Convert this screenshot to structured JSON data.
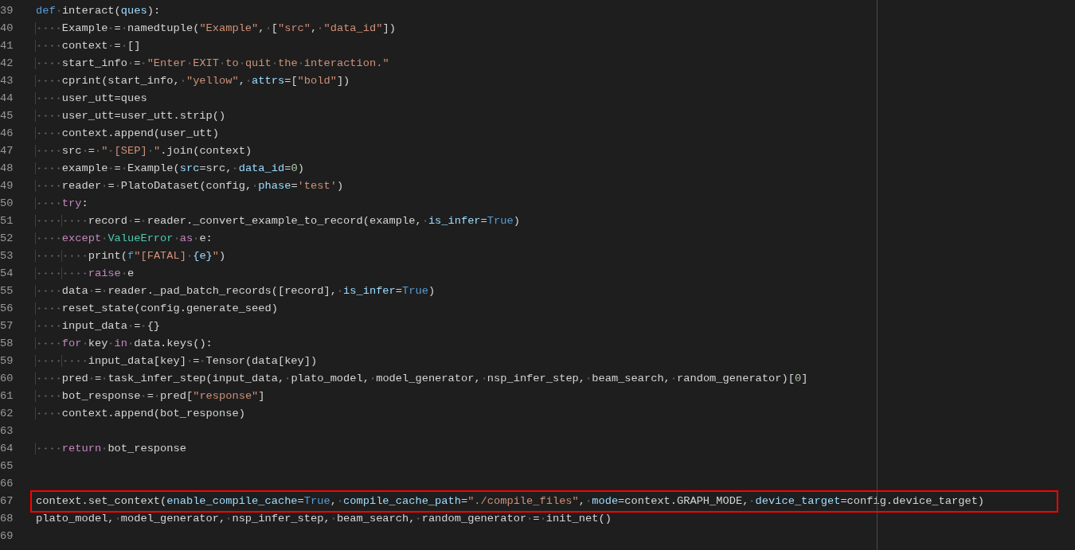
{
  "editor": {
    "lines": [
      {
        "number": "39",
        "highlighted": false,
        "tokens": [
          {
            "text": "def",
            "kind": "keyword"
          },
          {
            "text": " interact(",
            "kind": "plain"
          },
          {
            "text": "ques",
            "kind": "param"
          },
          {
            "text": "):",
            "kind": "plain"
          }
        ]
      },
      {
        "number": "40",
        "highlighted": false,
        "tokens": [
          {
            "text": "    Example = namedtuple(",
            "kind": "plain"
          },
          {
            "text": "\"Example\"",
            "kind": "string"
          },
          {
            "text": ", [",
            "kind": "plain"
          },
          {
            "text": "\"src\"",
            "kind": "string"
          },
          {
            "text": ", ",
            "kind": "plain"
          },
          {
            "text": "\"data_id\"",
            "kind": "string"
          },
          {
            "text": "])",
            "kind": "plain"
          }
        ]
      },
      {
        "number": "41",
        "highlighted": false,
        "tokens": [
          {
            "text": "    context = []",
            "kind": "plain"
          }
        ]
      },
      {
        "number": "42",
        "highlighted": false,
        "tokens": [
          {
            "text": "    start_info = ",
            "kind": "plain"
          },
          {
            "text": "\"Enter EXIT to quit the interaction.\"",
            "kind": "string"
          }
        ]
      },
      {
        "number": "43",
        "highlighted": false,
        "tokens": [
          {
            "text": "    cprint(start_info, ",
            "kind": "plain"
          },
          {
            "text": "\"yellow\"",
            "kind": "string"
          },
          {
            "text": ", ",
            "kind": "plain"
          },
          {
            "text": "attrs",
            "kind": "param"
          },
          {
            "text": "=[",
            "kind": "plain"
          },
          {
            "text": "\"bold\"",
            "kind": "string"
          },
          {
            "text": "])",
            "kind": "plain"
          }
        ]
      },
      {
        "number": "44",
        "highlighted": false,
        "tokens": [
          {
            "text": "    user_utt=ques",
            "kind": "plain"
          }
        ]
      },
      {
        "number": "45",
        "highlighted": false,
        "tokens": [
          {
            "text": "    user_utt=user_utt.strip()",
            "kind": "plain"
          }
        ]
      },
      {
        "number": "46",
        "highlighted": false,
        "tokens": [
          {
            "text": "    context.append(user_utt)",
            "kind": "plain"
          }
        ]
      },
      {
        "number": "47",
        "highlighted": false,
        "tokens": [
          {
            "text": "    src = ",
            "kind": "plain"
          },
          {
            "text": "\" [SEP] \"",
            "kind": "string"
          },
          {
            "text": ".join(context)",
            "kind": "plain"
          }
        ]
      },
      {
        "number": "48",
        "highlighted": false,
        "tokens": [
          {
            "text": "    example = Example(",
            "kind": "plain"
          },
          {
            "text": "src",
            "kind": "param"
          },
          {
            "text": "=src, ",
            "kind": "plain"
          },
          {
            "text": "data_id",
            "kind": "param"
          },
          {
            "text": "=",
            "kind": "plain"
          },
          {
            "text": "0",
            "kind": "number"
          },
          {
            "text": ")",
            "kind": "plain"
          }
        ]
      },
      {
        "number": "49",
        "highlighted": false,
        "tokens": [
          {
            "text": "    reader = PlatoDataset(config, ",
            "kind": "plain"
          },
          {
            "text": "phase",
            "kind": "param"
          },
          {
            "text": "=",
            "kind": "plain"
          },
          {
            "text": "'test'",
            "kind": "string"
          },
          {
            "text": ")",
            "kind": "plain"
          }
        ]
      },
      {
        "number": "50",
        "highlighted": false,
        "tokens": [
          {
            "text": "    try",
            "kind": "control"
          },
          {
            "text": ":",
            "kind": "plain"
          }
        ]
      },
      {
        "number": "51",
        "highlighted": false,
        "tokens": [
          {
            "text": "        record = reader._convert_example_to_record(example, ",
            "kind": "plain"
          },
          {
            "text": "is_infer",
            "kind": "param"
          },
          {
            "text": "=",
            "kind": "plain"
          },
          {
            "text": "True",
            "kind": "keyword"
          },
          {
            "text": ")",
            "kind": "plain"
          }
        ]
      },
      {
        "number": "52",
        "highlighted": false,
        "tokens": [
          {
            "text": "    except",
            "kind": "control"
          },
          {
            "text": " ValueError",
            "kind": "type"
          },
          {
            "text": " as",
            "kind": "control"
          },
          {
            "text": " e:",
            "kind": "plain"
          }
        ]
      },
      {
        "number": "53",
        "highlighted": false,
        "tokens": [
          {
            "text": "        print(",
            "kind": "plain"
          },
          {
            "text": "f",
            "kind": "keyword"
          },
          {
            "text": "\"[FATAL] ",
            "kind": "string"
          },
          {
            "text": "{e}",
            "kind": "param"
          },
          {
            "text": "\"",
            "kind": "string"
          },
          {
            "text": ")",
            "kind": "plain"
          }
        ]
      },
      {
        "number": "54",
        "highlighted": false,
        "tokens": [
          {
            "text": "        raise",
            "kind": "control"
          },
          {
            "text": " e",
            "kind": "plain"
          }
        ]
      },
      {
        "number": "55",
        "highlighted": false,
        "tokens": [
          {
            "text": "    data = reader._pad_batch_records([record], ",
            "kind": "plain"
          },
          {
            "text": "is_infer",
            "kind": "param"
          },
          {
            "text": "=",
            "kind": "plain"
          },
          {
            "text": "True",
            "kind": "keyword"
          },
          {
            "text": ")",
            "kind": "plain"
          }
        ]
      },
      {
        "number": "56",
        "highlighted": false,
        "tokens": [
          {
            "text": "    reset_state(config.generate_seed)",
            "kind": "plain"
          }
        ]
      },
      {
        "number": "57",
        "highlighted": false,
        "tokens": [
          {
            "text": "    input_data = {}",
            "kind": "plain"
          }
        ]
      },
      {
        "number": "58",
        "highlighted": false,
        "tokens": [
          {
            "text": "    for",
            "kind": "control"
          },
          {
            "text": " key ",
            "kind": "plain"
          },
          {
            "text": "in",
            "kind": "control"
          },
          {
            "text": " data.keys():",
            "kind": "plain"
          }
        ]
      },
      {
        "number": "59",
        "highlighted": false,
        "tokens": [
          {
            "text": "        input_data[key] = Tensor(data[key])",
            "kind": "plain"
          }
        ]
      },
      {
        "number": "60",
        "highlighted": false,
        "tokens": [
          {
            "text": "    pred = task_infer_step(input_data, plato_model, model_generator, nsp_infer_step, beam_search, random_generator)[",
            "kind": "plain"
          },
          {
            "text": "0",
            "kind": "number"
          },
          {
            "text": "]",
            "kind": "plain"
          }
        ]
      },
      {
        "number": "61",
        "highlighted": false,
        "tokens": [
          {
            "text": "    bot_response = pred[",
            "kind": "plain"
          },
          {
            "text": "\"response\"",
            "kind": "string"
          },
          {
            "text": "]",
            "kind": "plain"
          }
        ]
      },
      {
        "number": "62",
        "highlighted": false,
        "tokens": [
          {
            "text": "    context.append(bot_response)",
            "kind": "plain"
          }
        ]
      },
      {
        "number": "63",
        "highlighted": false
      },
      {
        "number": "64",
        "highlighted": false,
        "tokens": [
          {
            "text": "    return",
            "kind": "control"
          },
          {
            "text": " bot_response",
            "kind": "plain"
          }
        ]
      },
      {
        "number": "65",
        "highlighted": false
      },
      {
        "number": "66",
        "highlighted": false
      },
      {
        "number": "67",
        "highlighted": true,
        "tokens": [
          {
            "text": "context.set_context(",
            "kind": "plain"
          },
          {
            "text": "enable_compile_cache",
            "kind": "param"
          },
          {
            "text": "=",
            "kind": "plain"
          },
          {
            "text": "True",
            "kind": "keyword"
          },
          {
            "text": ", ",
            "kind": "plain"
          },
          {
            "text": "compile_cache_path",
            "kind": "param"
          },
          {
            "text": "=",
            "kind": "plain"
          },
          {
            "text": "\"./compile_files\"",
            "kind": "string"
          },
          {
            "text": ", ",
            "kind": "plain"
          },
          {
            "text": "mode",
            "kind": "param"
          },
          {
            "text": "=context.GRAPH_MODE, ",
            "kind": "plain"
          },
          {
            "text": "device_target",
            "kind": "param"
          },
          {
            "text": "=config.device_target)",
            "kind": "plain"
          }
        ]
      },
      {
        "number": "68",
        "highlighted": false,
        "tokens": [
          {
            "text": "plato_model, model_generator, nsp_infer_step, beam_search, random_generator = init_net()",
            "kind": "plain"
          }
        ]
      },
      {
        "number": "69",
        "highlighted": false
      }
    ]
  }
}
